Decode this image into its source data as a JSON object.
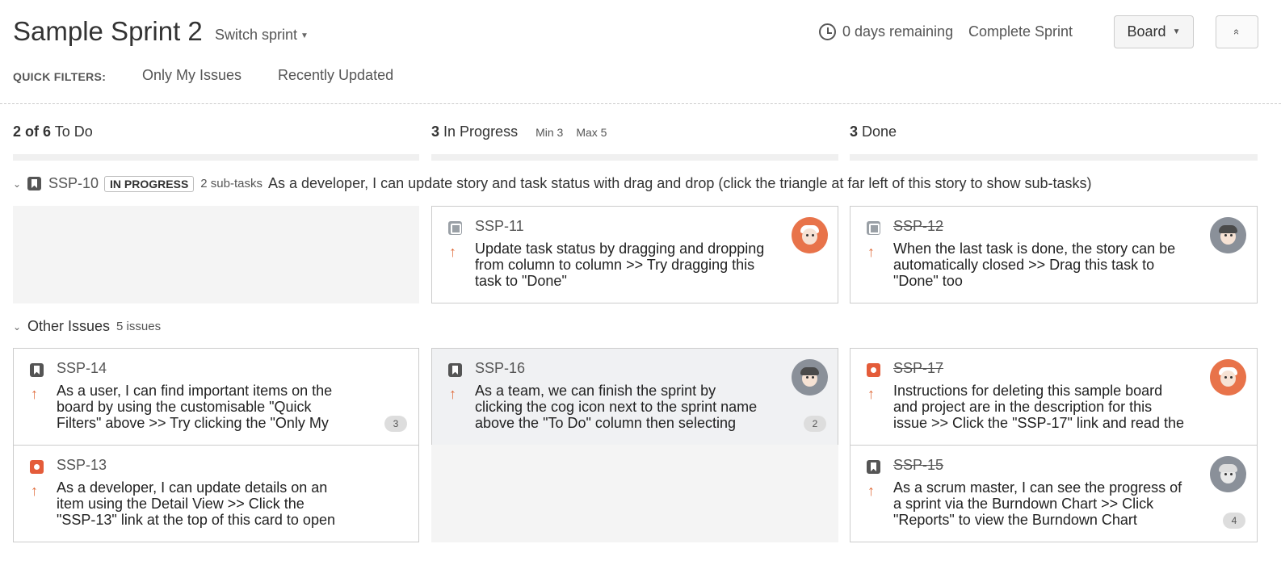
{
  "header": {
    "title": "Sample Sprint 2",
    "switch_sprint": "Switch sprint",
    "days_remaining": "0 days remaining",
    "complete_sprint": "Complete Sprint",
    "board_button": "Board",
    "collapse_glyph": "«"
  },
  "quick_filters": {
    "label": "QUICK FILTERS:",
    "items": [
      "Only My Issues",
      "Recently Updated"
    ]
  },
  "columns": [
    {
      "count": "2 of 6",
      "name": "To Do",
      "min": "",
      "max": ""
    },
    {
      "count": "3",
      "name": "In Progress",
      "min": "Min 3",
      "max": "Max 5"
    },
    {
      "count": "3",
      "name": "Done",
      "min": "",
      "max": ""
    }
  ],
  "swimlanes": [
    {
      "key": "SSP-10",
      "status": "IN PROGRESS",
      "subtasks": "2 sub-tasks",
      "summary": "As a developer, I can update story and task status with drag and drop (click the triangle at far left of this story to show sub-tasks)"
    },
    {
      "title": "Other Issues",
      "count": "5 issues"
    }
  ],
  "cards": {
    "ssp11": {
      "key": "SSP-11",
      "type_icon": "subtask-icon",
      "summary": [
        "Update task status by dragging and dropping",
        "from column to column >> Try dragging this",
        "task to \"Done\""
      ],
      "avatar": "orange"
    },
    "ssp12": {
      "key": "SSP-12",
      "type_icon": "subtask-icon",
      "summary": [
        "When the last task is done, the story can be",
        "automatically closed >> Drag this task to",
        "\"Done\" too"
      ],
      "avatar": "grey"
    },
    "ssp14": {
      "key": "SSP-14",
      "type_icon": "story-icon",
      "summary": [
        "As a user, I can find important items on the",
        "board by using the customisable \"Quick",
        "Filters\" above >> Try clicking the \"Only My"
      ],
      "badge": "3"
    },
    "ssp16": {
      "key": "SSP-16",
      "type_icon": "story-icon",
      "summary": [
        "As a team, we can finish the sprint by",
        "clicking the cog icon next to the sprint name",
        "above the \"To Do\" column then selecting"
      ],
      "badge": "2",
      "avatar": "grey"
    },
    "ssp17": {
      "key": "SSP-17",
      "type_icon": "bug-icon",
      "summary": [
        "Instructions for deleting this sample board",
        "and project are in the description for this",
        "issue >> Click the \"SSP-17\" link and read the"
      ],
      "avatar": "orange"
    },
    "ssp13": {
      "key": "SSP-13",
      "type_icon": "bug-icon",
      "summary": [
        "As a developer, I can update details on an",
        "item using the Detail View >> Click the",
        "\"SSP-13\" link at the top of this card to open"
      ]
    },
    "ssp15": {
      "key": "SSP-15",
      "type_icon": "story-icon",
      "summary": [
        "As a scrum master, I can see the progress of",
        "a sprint via the Burndown Chart >> Click",
        "\"Reports\" to view the Burndown Chart"
      ],
      "badge": "4",
      "avatar": "grey"
    }
  },
  "priority_glyph": "↑",
  "colors": {
    "accent_orange": "#e8734a",
    "priority_orange": "#e06c3c",
    "bug_red": "#e45c3a"
  }
}
